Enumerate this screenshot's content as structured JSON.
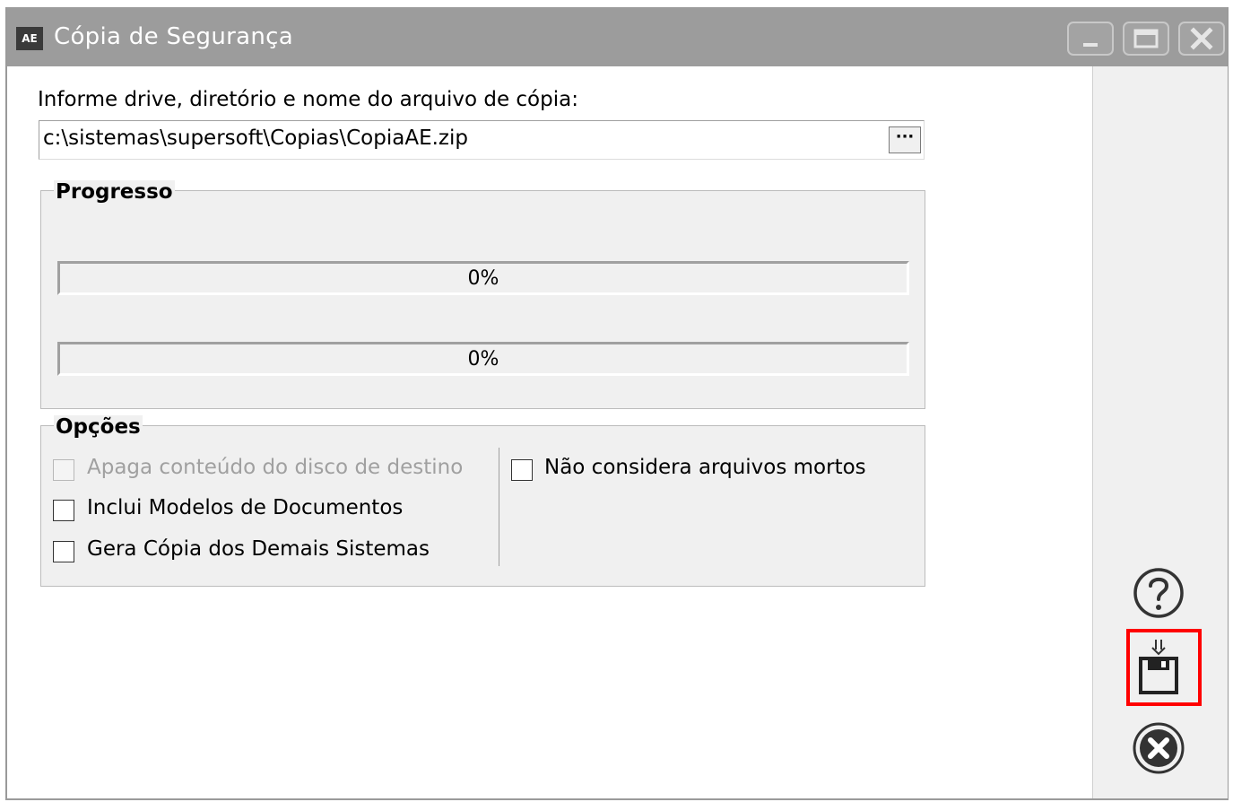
{
  "window": {
    "app_icon_text": "AE",
    "title": "Cópia de Segurança",
    "controls": [
      "minimize",
      "maximize",
      "close"
    ]
  },
  "form": {
    "path_label": "Informe drive, diretório e nome do arquivo de cópia:",
    "path_value": "c:\\sistemas\\supersoft\\Copias\\CopiaAE.zip",
    "browse_label": "···"
  },
  "progress": {
    "title": "Progresso",
    "bars": [
      {
        "text": "0%",
        "value": 0
      },
      {
        "text": "0%",
        "value": 0
      }
    ],
    "fill_color": "#06b025"
  },
  "options": {
    "title": "Opções",
    "apaga_label": "Apaga conteúdo do disco de destino",
    "apaga_disabled": true,
    "inclui_label": "Inclui Modelos de Documentos",
    "gera_label": "Gera Cópia dos Demais Sistemas",
    "nao_considera_label": "Não considera arquivos mortos",
    "checked": false
  },
  "side_buttons": {
    "help_icon": "question-circle-icon",
    "save_icon": "floppy-disk-download-icon",
    "cancel_icon": "x-circle-icon",
    "highlight_color": "#ff0000"
  }
}
